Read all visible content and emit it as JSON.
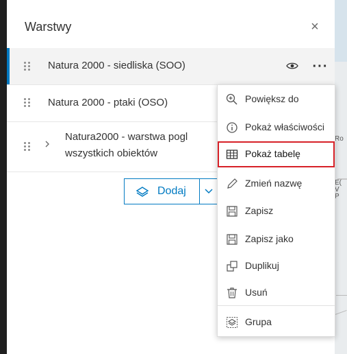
{
  "panel": {
    "title": "Warstwy",
    "close_icon": "×"
  },
  "layers": [
    {
      "name": "Natura 2000 - siedliska (SOO)",
      "selected": true
    },
    {
      "name": "Natura 2000 - ptaki (OSO)"
    },
    {
      "name_line1": "Natura2000 - warstwa pogl",
      "name_line2": "wszystkich obiektów"
    }
  ],
  "add_button": {
    "label": "Dodaj"
  },
  "context_menu": {
    "items": [
      {
        "label": "Powiększ do",
        "icon": "zoom-to-icon"
      },
      {
        "label": "Pokaż właściwości",
        "icon": "info-icon"
      },
      {
        "label": "Pokaż tabelę",
        "icon": "table-icon",
        "highlighted": true
      },
      {
        "label": "Zmień nazwę",
        "icon": "pencil-icon"
      },
      {
        "label": "Zapisz",
        "icon": "save-icon"
      },
      {
        "label": "Zapisz jako",
        "icon": "save-as-icon"
      },
      {
        "label": "Duplikuj",
        "icon": "duplicate-icon"
      },
      {
        "label": "Usuń",
        "icon": "trash-icon"
      },
      {
        "label": "Grupa",
        "icon": "group-icon"
      }
    ]
  },
  "map_edge_labels": [
    "Ro",
    "E(",
    "V",
    "P"
  ],
  "colors": {
    "accent": "#007ac2",
    "highlight_box": "#d72027",
    "left_bar": "#1f1f1f"
  }
}
